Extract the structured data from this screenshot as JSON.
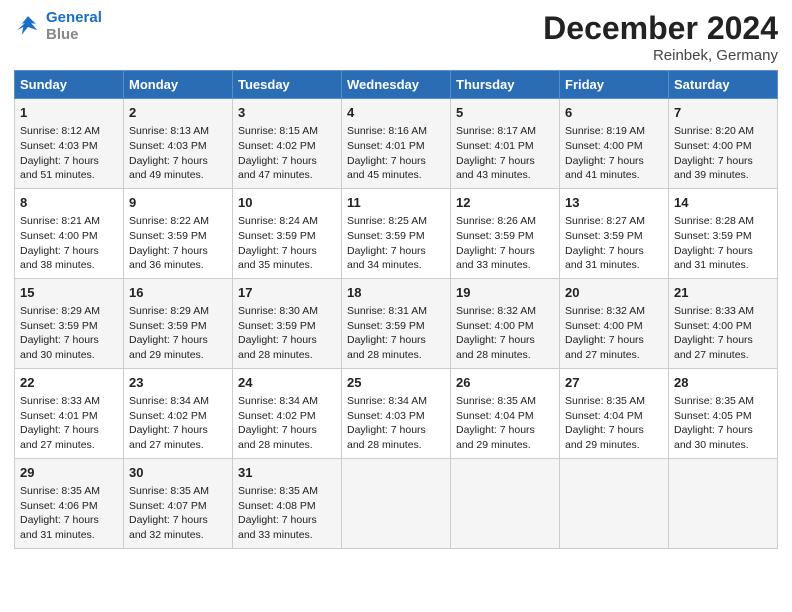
{
  "header": {
    "logo_line1": "General",
    "logo_line2": "Blue",
    "title": "December 2024",
    "subtitle": "Reinbek, Germany"
  },
  "columns": [
    "Sunday",
    "Monday",
    "Tuesday",
    "Wednesday",
    "Thursday",
    "Friday",
    "Saturday"
  ],
  "weeks": [
    [
      {
        "day": "1",
        "sunrise": "Sunrise: 8:12 AM",
        "sunset": "Sunset: 4:03 PM",
        "daylight": "Daylight: 7 hours and 51 minutes."
      },
      {
        "day": "2",
        "sunrise": "Sunrise: 8:13 AM",
        "sunset": "Sunset: 4:03 PM",
        "daylight": "Daylight: 7 hours and 49 minutes."
      },
      {
        "day": "3",
        "sunrise": "Sunrise: 8:15 AM",
        "sunset": "Sunset: 4:02 PM",
        "daylight": "Daylight: 7 hours and 47 minutes."
      },
      {
        "day": "4",
        "sunrise": "Sunrise: 8:16 AM",
        "sunset": "Sunset: 4:01 PM",
        "daylight": "Daylight: 7 hours and 45 minutes."
      },
      {
        "day": "5",
        "sunrise": "Sunrise: 8:17 AM",
        "sunset": "Sunset: 4:01 PM",
        "daylight": "Daylight: 7 hours and 43 minutes."
      },
      {
        "day": "6",
        "sunrise": "Sunrise: 8:19 AM",
        "sunset": "Sunset: 4:00 PM",
        "daylight": "Daylight: 7 hours and 41 minutes."
      },
      {
        "day": "7",
        "sunrise": "Sunrise: 8:20 AM",
        "sunset": "Sunset: 4:00 PM",
        "daylight": "Daylight: 7 hours and 39 minutes."
      }
    ],
    [
      {
        "day": "8",
        "sunrise": "Sunrise: 8:21 AM",
        "sunset": "Sunset: 4:00 PM",
        "daylight": "Daylight: 7 hours and 38 minutes."
      },
      {
        "day": "9",
        "sunrise": "Sunrise: 8:22 AM",
        "sunset": "Sunset: 3:59 PM",
        "daylight": "Daylight: 7 hours and 36 minutes."
      },
      {
        "day": "10",
        "sunrise": "Sunrise: 8:24 AM",
        "sunset": "Sunset: 3:59 PM",
        "daylight": "Daylight: 7 hours and 35 minutes."
      },
      {
        "day": "11",
        "sunrise": "Sunrise: 8:25 AM",
        "sunset": "Sunset: 3:59 PM",
        "daylight": "Daylight: 7 hours and 34 minutes."
      },
      {
        "day": "12",
        "sunrise": "Sunrise: 8:26 AM",
        "sunset": "Sunset: 3:59 PM",
        "daylight": "Daylight: 7 hours and 33 minutes."
      },
      {
        "day": "13",
        "sunrise": "Sunrise: 8:27 AM",
        "sunset": "Sunset: 3:59 PM",
        "daylight": "Daylight: 7 hours and 31 minutes."
      },
      {
        "day": "14",
        "sunrise": "Sunrise: 8:28 AM",
        "sunset": "Sunset: 3:59 PM",
        "daylight": "Daylight: 7 hours and 31 minutes."
      }
    ],
    [
      {
        "day": "15",
        "sunrise": "Sunrise: 8:29 AM",
        "sunset": "Sunset: 3:59 PM",
        "daylight": "Daylight: 7 hours and 30 minutes."
      },
      {
        "day": "16",
        "sunrise": "Sunrise: 8:29 AM",
        "sunset": "Sunset: 3:59 PM",
        "daylight": "Daylight: 7 hours and 29 minutes."
      },
      {
        "day": "17",
        "sunrise": "Sunrise: 8:30 AM",
        "sunset": "Sunset: 3:59 PM",
        "daylight": "Daylight: 7 hours and 28 minutes."
      },
      {
        "day": "18",
        "sunrise": "Sunrise: 8:31 AM",
        "sunset": "Sunset: 3:59 PM",
        "daylight": "Daylight: 7 hours and 28 minutes."
      },
      {
        "day": "19",
        "sunrise": "Sunrise: 8:32 AM",
        "sunset": "Sunset: 4:00 PM",
        "daylight": "Daylight: 7 hours and 28 minutes."
      },
      {
        "day": "20",
        "sunrise": "Sunrise: 8:32 AM",
        "sunset": "Sunset: 4:00 PM",
        "daylight": "Daylight: 7 hours and 27 minutes."
      },
      {
        "day": "21",
        "sunrise": "Sunrise: 8:33 AM",
        "sunset": "Sunset: 4:00 PM",
        "daylight": "Daylight: 7 hours and 27 minutes."
      }
    ],
    [
      {
        "day": "22",
        "sunrise": "Sunrise: 8:33 AM",
        "sunset": "Sunset: 4:01 PM",
        "daylight": "Daylight: 7 hours and 27 minutes."
      },
      {
        "day": "23",
        "sunrise": "Sunrise: 8:34 AM",
        "sunset": "Sunset: 4:02 PM",
        "daylight": "Daylight: 7 hours and 27 minutes."
      },
      {
        "day": "24",
        "sunrise": "Sunrise: 8:34 AM",
        "sunset": "Sunset: 4:02 PM",
        "daylight": "Daylight: 7 hours and 28 minutes."
      },
      {
        "day": "25",
        "sunrise": "Sunrise: 8:34 AM",
        "sunset": "Sunset: 4:03 PM",
        "daylight": "Daylight: 7 hours and 28 minutes."
      },
      {
        "day": "26",
        "sunrise": "Sunrise: 8:35 AM",
        "sunset": "Sunset: 4:04 PM",
        "daylight": "Daylight: 7 hours and 29 minutes."
      },
      {
        "day": "27",
        "sunrise": "Sunrise: 8:35 AM",
        "sunset": "Sunset: 4:04 PM",
        "daylight": "Daylight: 7 hours and 29 minutes."
      },
      {
        "day": "28",
        "sunrise": "Sunrise: 8:35 AM",
        "sunset": "Sunset: 4:05 PM",
        "daylight": "Daylight: 7 hours and 30 minutes."
      }
    ],
    [
      {
        "day": "29",
        "sunrise": "Sunrise: 8:35 AM",
        "sunset": "Sunset: 4:06 PM",
        "daylight": "Daylight: 7 hours and 31 minutes."
      },
      {
        "day": "30",
        "sunrise": "Sunrise: 8:35 AM",
        "sunset": "Sunset: 4:07 PM",
        "daylight": "Daylight: 7 hours and 32 minutes."
      },
      {
        "day": "31",
        "sunrise": "Sunrise: 8:35 AM",
        "sunset": "Sunset: 4:08 PM",
        "daylight": "Daylight: 7 hours and 33 minutes."
      },
      null,
      null,
      null,
      null
    ]
  ]
}
